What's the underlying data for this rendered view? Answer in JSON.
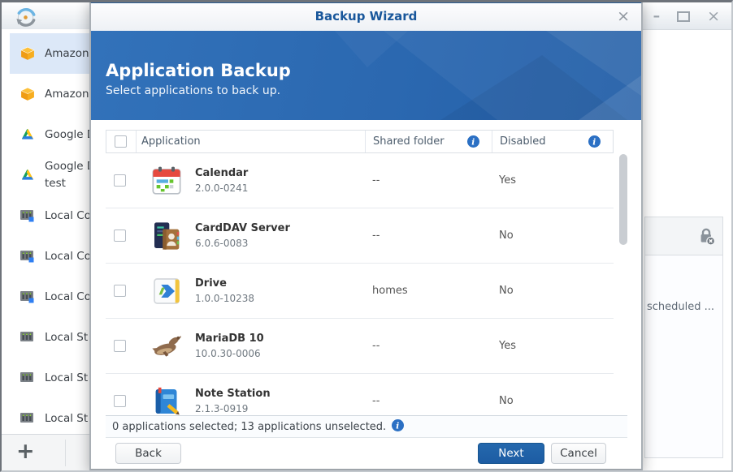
{
  "window": {
    "controls": {
      "minimize_glyph": "–",
      "close_glyph": "×"
    }
  },
  "sidebar": {
    "items": [
      {
        "label": "Amazon",
        "icon": "amazon-cube-icon",
        "selected": true
      },
      {
        "label": "Amazon",
        "icon": "amazon-cube-icon",
        "selected": false
      },
      {
        "label": "Google D",
        "icon": "google-drive-icon",
        "selected": false
      },
      {
        "label": "Google D\ntest",
        "icon": "google-drive-icon",
        "selected": false
      },
      {
        "label": "Local Co",
        "icon": "local-copy-server-icon",
        "selected": false
      },
      {
        "label": "Local Co",
        "icon": "local-copy-server-icon",
        "selected": false
      },
      {
        "label": "Local Co",
        "icon": "local-copy-server-icon",
        "selected": false
      },
      {
        "label": "Local St",
        "icon": "local-storage-server-icon",
        "selected": false
      },
      {
        "label": "Local St",
        "icon": "local-storage-server-icon",
        "selected": false
      },
      {
        "label": "Local St",
        "icon": "local-storage-server-icon",
        "selected": false
      }
    ],
    "add_button_glyph": "+"
  },
  "dialog": {
    "title": "Backup Wizard",
    "close_glyph": "×",
    "banner": {
      "title": "Application Backup",
      "subtitle": "Select applications to back up."
    },
    "table": {
      "columns": [
        {
          "label": "Application"
        },
        {
          "label": "Shared folder",
          "has_info": true
        },
        {
          "label": "Disabled",
          "has_info": true
        }
      ],
      "rows": [
        {
          "name": "Calendar",
          "version": "2.0.0-0241",
          "shared_folder": "--",
          "disabled": "Yes",
          "icon": "calendar-app-icon"
        },
        {
          "name": "CardDAV Server",
          "version": "6.0.6-0083",
          "shared_folder": "--",
          "disabled": "No",
          "icon": "carddav-server-app-icon"
        },
        {
          "name": "Drive",
          "version": "1.0.0-10238",
          "shared_folder": "homes",
          "disabled": "No",
          "icon": "drive-app-icon"
        },
        {
          "name": "MariaDB 10",
          "version": "10.0.30-0006",
          "shared_folder": "--",
          "disabled": "Yes",
          "icon": "mariadb-app-icon"
        },
        {
          "name": "Note Station",
          "version": "2.1.3-0919",
          "shared_folder": "--",
          "disabled": "No",
          "icon": "note-station-app-icon"
        }
      ]
    },
    "status_text": "0 applications selected; 13 applications unselected.",
    "buttons": {
      "back": "Back",
      "next": "Next",
      "cancel": "Cancel"
    }
  },
  "background_panel": {
    "partial_text": "scheduled ..."
  },
  "colors": {
    "banner_blue": "#2b68b0",
    "dialog_title_text": "#19579b",
    "next_button_blue": "#1f62a8",
    "info_icon_blue": "#2b70c4",
    "selected_item_bg": "#dce8f8"
  }
}
